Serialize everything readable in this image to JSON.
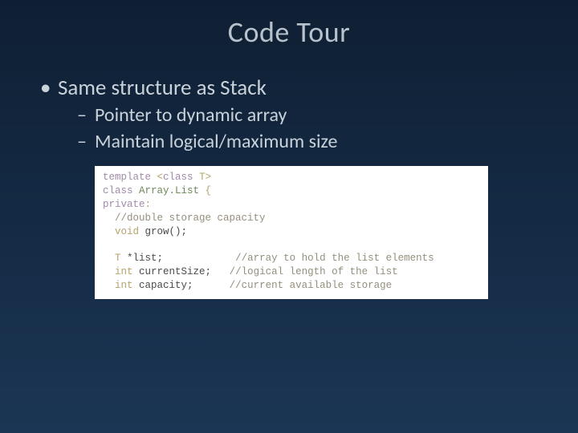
{
  "title": "Code Tour",
  "bullets": {
    "l1": "Same structure as Stack",
    "l2a": "Pointer to dynamic array",
    "l2b": "Maintain logical/maximum size"
  },
  "code": {
    "l1": {
      "kw1": "template",
      "lt": " <",
      "kw2": "class",
      "sp": " ",
      "t": "T",
      "gt": ">"
    },
    "l2": {
      "kw": "class",
      "sp": " ",
      "name": "Array.List",
      "brace": " {"
    },
    "l3": {
      "kw": "private",
      "colon": ":"
    },
    "l4": {
      "cmt": "  //double storage capacity"
    },
    "l5": {
      "pad": "  ",
      "ret": "void",
      "fn": " grow();"
    },
    "blank1": " ",
    "l6": {
      "pad": "  ",
      "t": "T",
      "ptr": " *list;",
      "pad2": "            ",
      "cmt": "//array to hold the list elements"
    },
    "l7": {
      "pad": "  ",
      "ty": "int",
      "id": " currentSize;",
      "pad2": "   ",
      "cmt": "//logical length of the list"
    },
    "l8": {
      "pad": "  ",
      "ty": "int",
      "id": " capacity;",
      "pad2": "      ",
      "cmt": "//current available storage"
    }
  }
}
